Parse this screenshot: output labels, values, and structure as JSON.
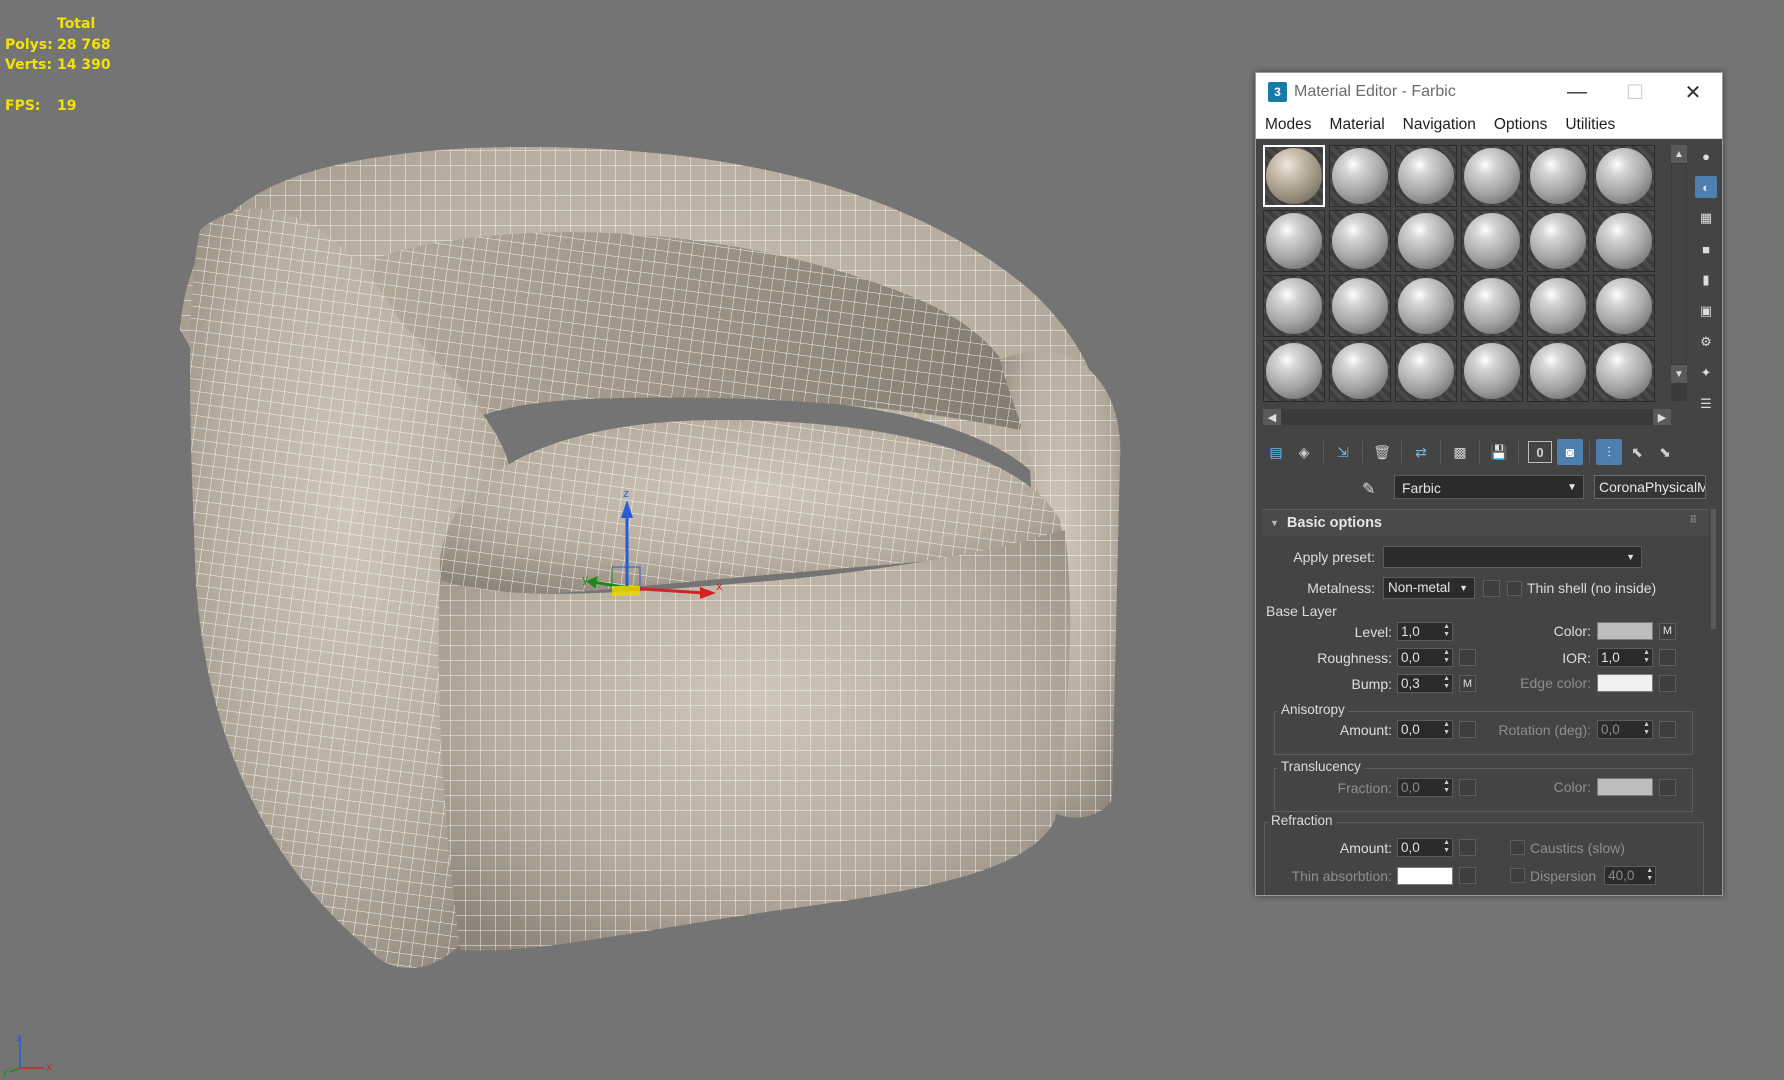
{
  "viewport": {
    "stats": {
      "total_label": "Total",
      "polys_label": "Polys:",
      "polys_value": "28 768",
      "verts_label": "Verts:",
      "verts_value": "14 390",
      "fps_label": "FPS:",
      "fps_value": "19"
    },
    "gizmo_axes": [
      "x",
      "y",
      "z"
    ],
    "corner_axes": [
      "y",
      "x",
      "z"
    ]
  },
  "material_editor": {
    "title": "Material Editor - Farbic",
    "app_icon": "3",
    "menu": [
      "Modes",
      "Material",
      "Navigation",
      "Options",
      "Utilities"
    ],
    "material_name": "Farbic",
    "material_type": "CoronaPhysicalMt",
    "rollout_title": "Basic options",
    "apply_preset_label": "Apply preset:",
    "apply_preset_value": "",
    "metalness_label": "Metalness:",
    "metalness_value": "Non-metal",
    "thin_shell_label": "Thin shell (no inside)",
    "base_layer": {
      "title": "Base Layer",
      "level_label": "Level:",
      "level_value": "1,0",
      "color_label": "Color:",
      "color_map_btn": "M",
      "roughness_label": "Roughness:",
      "roughness_value": "0,0",
      "ior_label": "IOR:",
      "ior_value": "1,0",
      "bump_label": "Bump:",
      "bump_value": "0,3",
      "bump_map_btn": "M",
      "edge_color_label": "Edge color:"
    },
    "anisotropy": {
      "title": "Anisotropy",
      "amount_label": "Amount:",
      "amount_value": "0,0",
      "rotation_label": "Rotation (deg):",
      "rotation_value": "0,0"
    },
    "translucency": {
      "title": "Translucency",
      "fraction_label": "Fraction:",
      "fraction_value": "0,0",
      "color_label": "Color:"
    },
    "refraction": {
      "title": "Refraction",
      "amount_label": "Amount:",
      "amount_value": "0,0",
      "caustics_label": "Caustics (slow)",
      "thin_absorption_label": "Thin absorbtion:",
      "dispersion_label": "Dispersion",
      "dispersion_value": "40,0"
    },
    "icons": {
      "close": "close-icon",
      "minimize": "minimize-icon",
      "maximize": "maximize-icon",
      "picker": "eyedropper-icon"
    },
    "colors": {
      "viewport_bg": "#747474",
      "stats_text": "#f2e400",
      "panel_bg": "#444444",
      "accent": "#4f7fae"
    }
  }
}
